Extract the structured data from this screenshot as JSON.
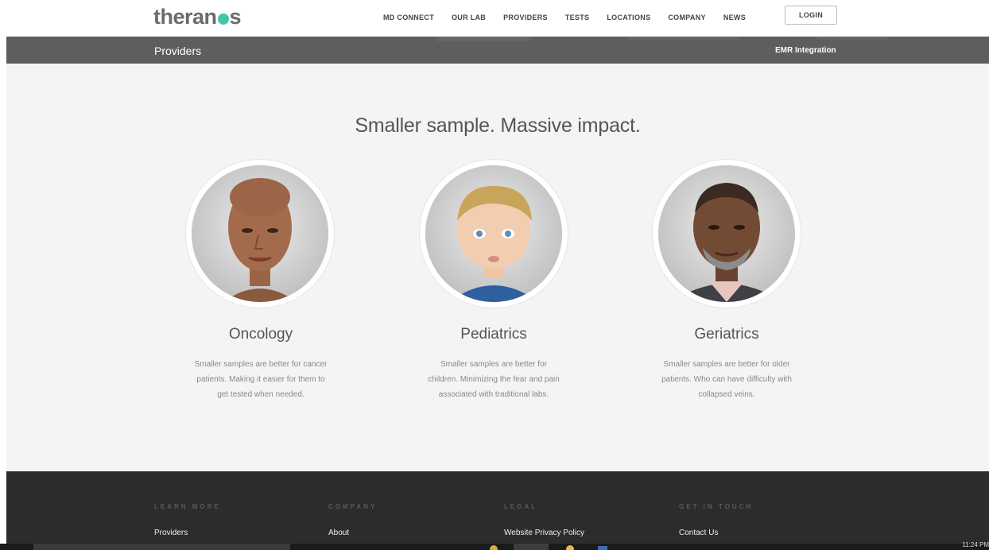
{
  "header": {
    "logo_left": "theran",
    "logo_right": "s",
    "nav": [
      "MD CONNECT",
      "OUR LAB",
      "PROVIDERS",
      "TESTS",
      "LOCATIONS",
      "COMPANY",
      "NEWS"
    ],
    "login_label": "LOGIN"
  },
  "subbar": {
    "title": "Providers",
    "link": "EMR Integration"
  },
  "main": {
    "headline": "Smaller sample. Massive impact.",
    "categories": [
      {
        "title": "Oncology",
        "lines": [
          "Smaller samples are better for cancer",
          "patients. Making it easier for them to",
          "get tested when needed."
        ]
      },
      {
        "title": "Pediatrics",
        "lines": [
          "Smaller samples are better for",
          "children. Minimizing the fear and pain",
          "associated with traditional labs."
        ]
      },
      {
        "title": "Geriatrics",
        "lines": [
          "Smaller samples are better for older",
          "patients. Who can have difficulty with",
          "collapsed veins."
        ]
      }
    ]
  },
  "footer": {
    "columns": [
      {
        "heading": "LEARN MORE",
        "link": "Providers"
      },
      {
        "heading": "COMPANY",
        "link": "About"
      },
      {
        "heading": "LEGAL",
        "link": "Website Privacy Policy"
      },
      {
        "heading": "GET IN TOUCH",
        "link": "Contact Us"
      }
    ]
  },
  "taskbar": {
    "clock": "11:24 PM"
  },
  "colors": {
    "brand_dot": "#3ec8a8",
    "subbar": "#5e5e5e",
    "footer": "#2c2c2c"
  }
}
